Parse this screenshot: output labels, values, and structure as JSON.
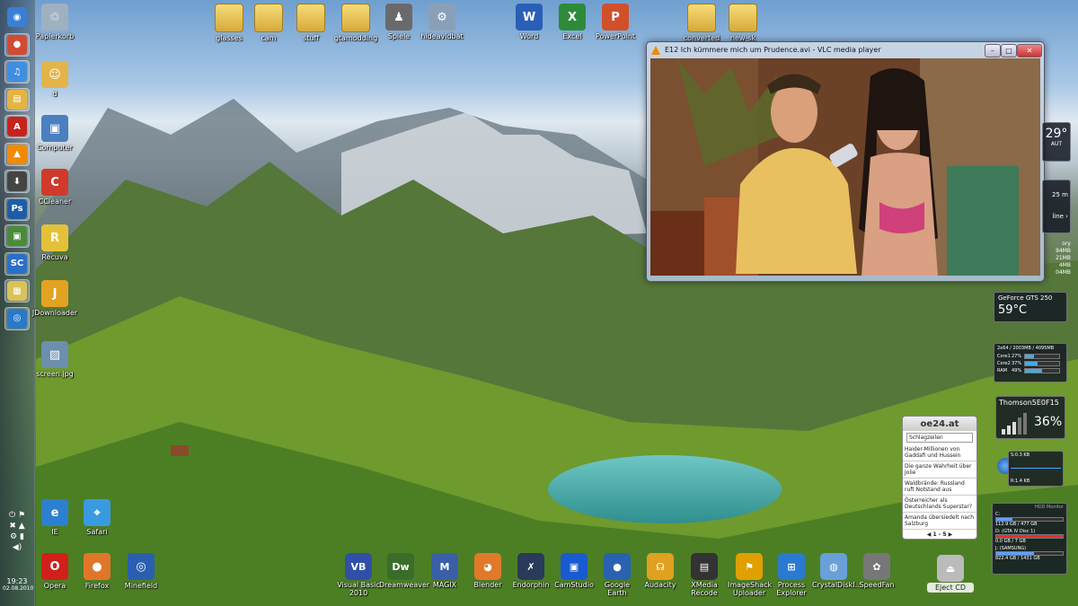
{
  "taskbar": {
    "clock_time": "19:23",
    "clock_date": "02.08.2010",
    "pinned": [
      {
        "name": "windows-start-icon",
        "glyph": "◉",
        "color": "#3a7fd5"
      },
      {
        "name": "chrome-icon",
        "glyph": "●",
        "color": "#d24a34"
      },
      {
        "name": "itunes-icon",
        "glyph": "♫",
        "color": "#3f8fe0"
      },
      {
        "name": "explorer-icon",
        "glyph": "▤",
        "color": "#e4b440"
      },
      {
        "name": "acrobat-icon",
        "glyph": "A",
        "color": "#c8221c"
      },
      {
        "name": "vlc-icon",
        "glyph": "▲",
        "color": "#f08a00"
      },
      {
        "name": "download-icon",
        "glyph": "⬇",
        "color": "#444"
      },
      {
        "name": "photoshop-icon",
        "glyph": "Ps",
        "color": "#1d5da8"
      },
      {
        "name": "network-icon",
        "glyph": "▣",
        "color": "#4a8b3a"
      },
      {
        "name": "screencapture-icon",
        "glyph": "SC",
        "color": "#2a6fc9"
      },
      {
        "name": "folders-icon",
        "glyph": "▦",
        "color": "#d9c25a"
      },
      {
        "name": "globe-icon",
        "glyph": "◎",
        "color": "#2a79c6"
      }
    ]
  },
  "desktop": {
    "icons": [
      {
        "label": "Papierkorb",
        "icon": "recycle-bin-icon",
        "glyph": "♲",
        "color": "#9fb0c0"
      },
      {
        "label": "d",
        "icon": "user-folder-icon",
        "glyph": "☺",
        "color": "#e2b44a"
      },
      {
        "label": "Computer",
        "icon": "computer-icon",
        "glyph": "▣",
        "color": "#4a7fc0"
      },
      {
        "label": "CCleaner",
        "icon": "ccleaner-icon",
        "glyph": "C",
        "color": "#d03a2a"
      },
      {
        "label": "Recuva",
        "icon": "recuva-icon",
        "glyph": "R",
        "color": "#e3c23a"
      },
      {
        "label": "JDownloader",
        "icon": "jdownloader-icon",
        "glyph": "J",
        "color": "#e3a322"
      },
      {
        "label": "screen.jpg",
        "icon": "image-file-icon",
        "glyph": "▨",
        "color": "#6d8fae"
      },
      {
        "label": "IE",
        "icon": "ie-icon",
        "glyph": "e",
        "color": "#2d7fd0"
      },
      {
        "label": "Safari",
        "icon": "safari-icon",
        "glyph": "⌖",
        "color": "#3a9ae0"
      },
      {
        "label": "Opera",
        "icon": "opera-icon",
        "glyph": "O",
        "color": "#d0201c"
      },
      {
        "label": "Firefox",
        "icon": "firefox-icon",
        "glyph": "●",
        "color": "#e0762a"
      },
      {
        "label": "Minefield",
        "icon": "minefield-icon",
        "glyph": "◎",
        "color": "#2a5fb0"
      }
    ],
    "top_icons": [
      {
        "label": "glasses",
        "icon": "folder-icon",
        "kind": "folder"
      },
      {
        "label": "cam",
        "icon": "folder-icon",
        "kind": "folder"
      },
      {
        "label": "stuff",
        "icon": "folder-icon",
        "kind": "folder"
      },
      {
        "label": "gtamodding",
        "icon": "folder-icon",
        "kind": "folder"
      },
      {
        "label": "Spiele",
        "icon": "games-icon",
        "kind": "app",
        "glyph": "♟",
        "color": "#6a6a6a"
      },
      {
        "label": "hideavidbat",
        "icon": "settings-file-icon",
        "kind": "app",
        "glyph": "⚙",
        "color": "#8aa0b8"
      },
      {
        "label": "Word",
        "icon": "word-icon",
        "kind": "app",
        "glyph": "W",
        "color": "#2a5fb8"
      },
      {
        "label": "Excel",
        "icon": "excel-icon",
        "kind": "app",
        "glyph": "X",
        "color": "#2d8a3a"
      },
      {
        "label": "PowerPoint",
        "icon": "powerpoint-icon",
        "kind": "app",
        "glyph": "P",
        "color": "#d0502a"
      },
      {
        "label": "converted",
        "icon": "folder-icon",
        "kind": "folder"
      },
      {
        "label": "new‑sk",
        "icon": "folder-icon",
        "kind": "folder"
      }
    ]
  },
  "vlc": {
    "title": "E12 Ich kümmere mich um Prudence.avi - VLC media player",
    "minimize": "–",
    "maximize": "□",
    "close": "✕"
  },
  "gadgets": {
    "weather": {
      "temp": "29°",
      "city": "AUT"
    },
    "clock_partial": {
      "line1": "25 m",
      "line2": "line ›"
    },
    "mem_partial": {
      "l1": "ory",
      "l2": "94MB",
      "l3": "21MB",
      "l4": "4MB",
      "l5": "04MB"
    },
    "gpu": {
      "name": "GeForce GTS 250",
      "temp": "59°C"
    },
    "cpu": {
      "header": "2x64 / 2003MB / 4095MB",
      "rows": [
        {
          "label": "Core1",
          "value": "27%",
          "pct": 27
        },
        {
          "label": "Core2",
          "value": "37%",
          "pct": 37
        },
        {
          "label": "RAM",
          "value": "49%",
          "pct": 49
        }
      ]
    },
    "wifi": {
      "name": "Thomson5E0F15",
      "percent": "36%"
    },
    "net": {
      "up": "S:0.3 KB",
      "down": "R:1.4 KB"
    },
    "hdd": {
      "title": "HDD Monitor",
      "drives": [
        {
          "name": "C:",
          "size": "112.9 GB / 477 GB",
          "pct": 24,
          "color": "#5fa0ff"
        },
        {
          "name": "D: (GTA IV Disc 1)",
          "size": "0.0 GB / 7 GB",
          "pct": 100,
          "color": "#e03030"
        },
        {
          "name": "J: (SAMSUNG)",
          "size": "822.4 GB / 1431 GB",
          "pct": 57,
          "color": "#5fa0ff"
        }
      ]
    },
    "news": {
      "logo": "oe24.at",
      "dropdown": "Schlagzeilen",
      "items": [
        "Haider-Millionen von Gaddafi und Hussein",
        "Die ganze Wahrheit über Jolie",
        "Waldbrände: Russland ruft Notstand aus",
        "Österreicher als Deutschlands Superstar?",
        "Amanda übersiedelt nach Salzburg"
      ],
      "pager": "◀ 1 - 5 ▶"
    }
  },
  "dock": {
    "apps": [
      {
        "label": "Visual Basic 2010",
        "icon": "visual-basic-icon",
        "glyph": "VB",
        "color": "#3050a8"
      },
      {
        "label": "Dreamweaver",
        "icon": "dreamweaver-icon",
        "glyph": "Dw",
        "color": "#3a6d2a"
      },
      {
        "label": "MAGIX",
        "icon": "magix-icon",
        "glyph": "M",
        "color": "#3a5fa8"
      },
      {
        "label": "Blender",
        "icon": "blender-icon",
        "glyph": "◕",
        "color": "#e07a2a"
      },
      {
        "label": "Endorphin",
        "icon": "endorphin-icon",
        "glyph": "✗",
        "color": "#2a3a5a"
      },
      {
        "label": "CamStudio",
        "icon": "camstudio-icon",
        "glyph": "▣",
        "color": "#1a5ad0"
      },
      {
        "label": "Google Earth",
        "icon": "google-earth-icon",
        "glyph": "●",
        "color": "#2a62b0"
      },
      {
        "label": "Audacity",
        "icon": "audacity-icon",
        "glyph": "☊",
        "color": "#e0a020"
      },
      {
        "label": "XMedia Recode",
        "icon": "xmedia-recode-icon",
        "glyph": "▤",
        "color": "#333"
      },
      {
        "label": "ImageShack Uploader",
        "icon": "imageshack-icon",
        "glyph": "⚑",
        "color": "#e0a000"
      },
      {
        "label": "Process Explorer",
        "icon": "process-explorer-icon",
        "glyph": "⊞",
        "color": "#2a7ad0"
      },
      {
        "label": "CrystalDiskI...",
        "icon": "crystaldisk-icon",
        "glyph": "◍",
        "color": "#6aa0d8"
      },
      {
        "label": "SpeedFan",
        "icon": "speedfan-icon",
        "glyph": "✿",
        "color": "#777"
      },
      {
        "label": "Eject CD",
        "icon": "eject-cd-icon",
        "glyph": "⏏",
        "color": "#bbb"
      }
    ]
  }
}
